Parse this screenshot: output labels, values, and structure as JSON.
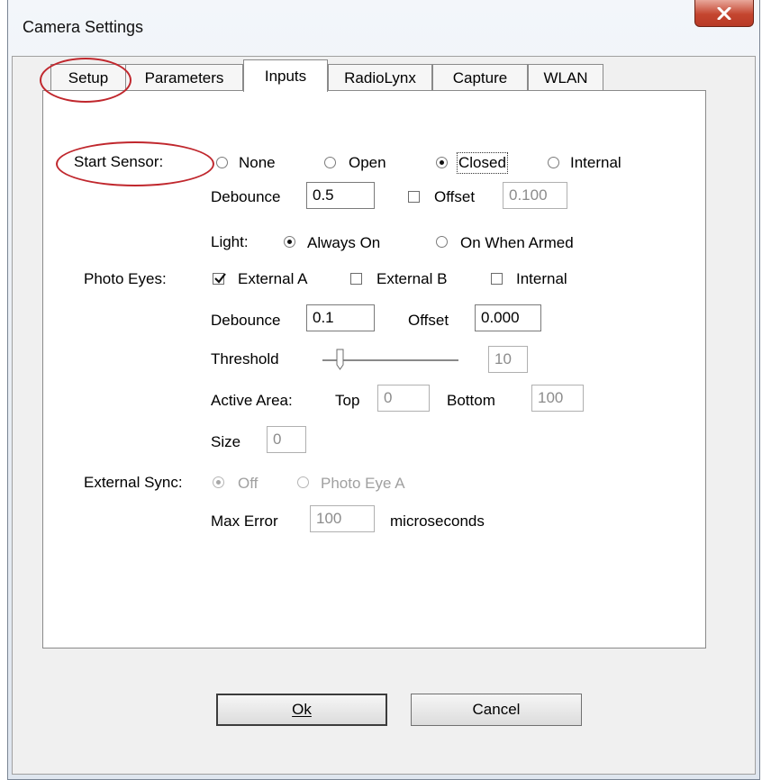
{
  "window": {
    "title": "Camera Settings",
    "close_glyph": "x"
  },
  "tabs": [
    {
      "label": "Setup",
      "active": false
    },
    {
      "label": "Parameters",
      "active": false
    },
    {
      "label": "Inputs",
      "active": true
    },
    {
      "label": "RadioLynx",
      "active": false
    },
    {
      "label": "Capture",
      "active": false
    },
    {
      "label": "WLAN",
      "active": false
    }
  ],
  "start_sensor": {
    "label": "Start Sensor:",
    "options": [
      "None",
      "Open",
      "Closed",
      "Internal"
    ],
    "selected": "Closed",
    "debounce_label": "Debounce",
    "debounce_value": "0.5",
    "offset_label": "Offset",
    "offset_checked": false,
    "offset_value": "0.100",
    "light_label": "Light:",
    "light_options": [
      "Always On",
      "On When Armed"
    ],
    "light_selected": "Always On"
  },
  "photo_eyes": {
    "label": "Photo Eyes:",
    "options": [
      {
        "label": "External A",
        "checked": true
      },
      {
        "label": "External B",
        "checked": false
      },
      {
        "label": "Internal",
        "checked": false
      }
    ],
    "debounce_label": "Debounce",
    "debounce_value": "0.1",
    "offset_label": "Offset",
    "offset_value": "0.000",
    "threshold_label": "Threshold",
    "threshold_value": "10",
    "active_area_label": "Active Area:",
    "top_label": "Top",
    "top_value": "0",
    "bottom_label": "Bottom",
    "bottom_value": "100",
    "size_label": "Size",
    "size_value": "0"
  },
  "external_sync": {
    "label": "External Sync:",
    "options": [
      "Off",
      "Photo Eye A"
    ],
    "selected": "Off",
    "max_error_label": "Max Error",
    "max_error_value": "100",
    "units": "microseconds"
  },
  "buttons": {
    "ok": "Ok",
    "cancel": "Cancel"
  },
  "annotation_color": "#c0272d"
}
